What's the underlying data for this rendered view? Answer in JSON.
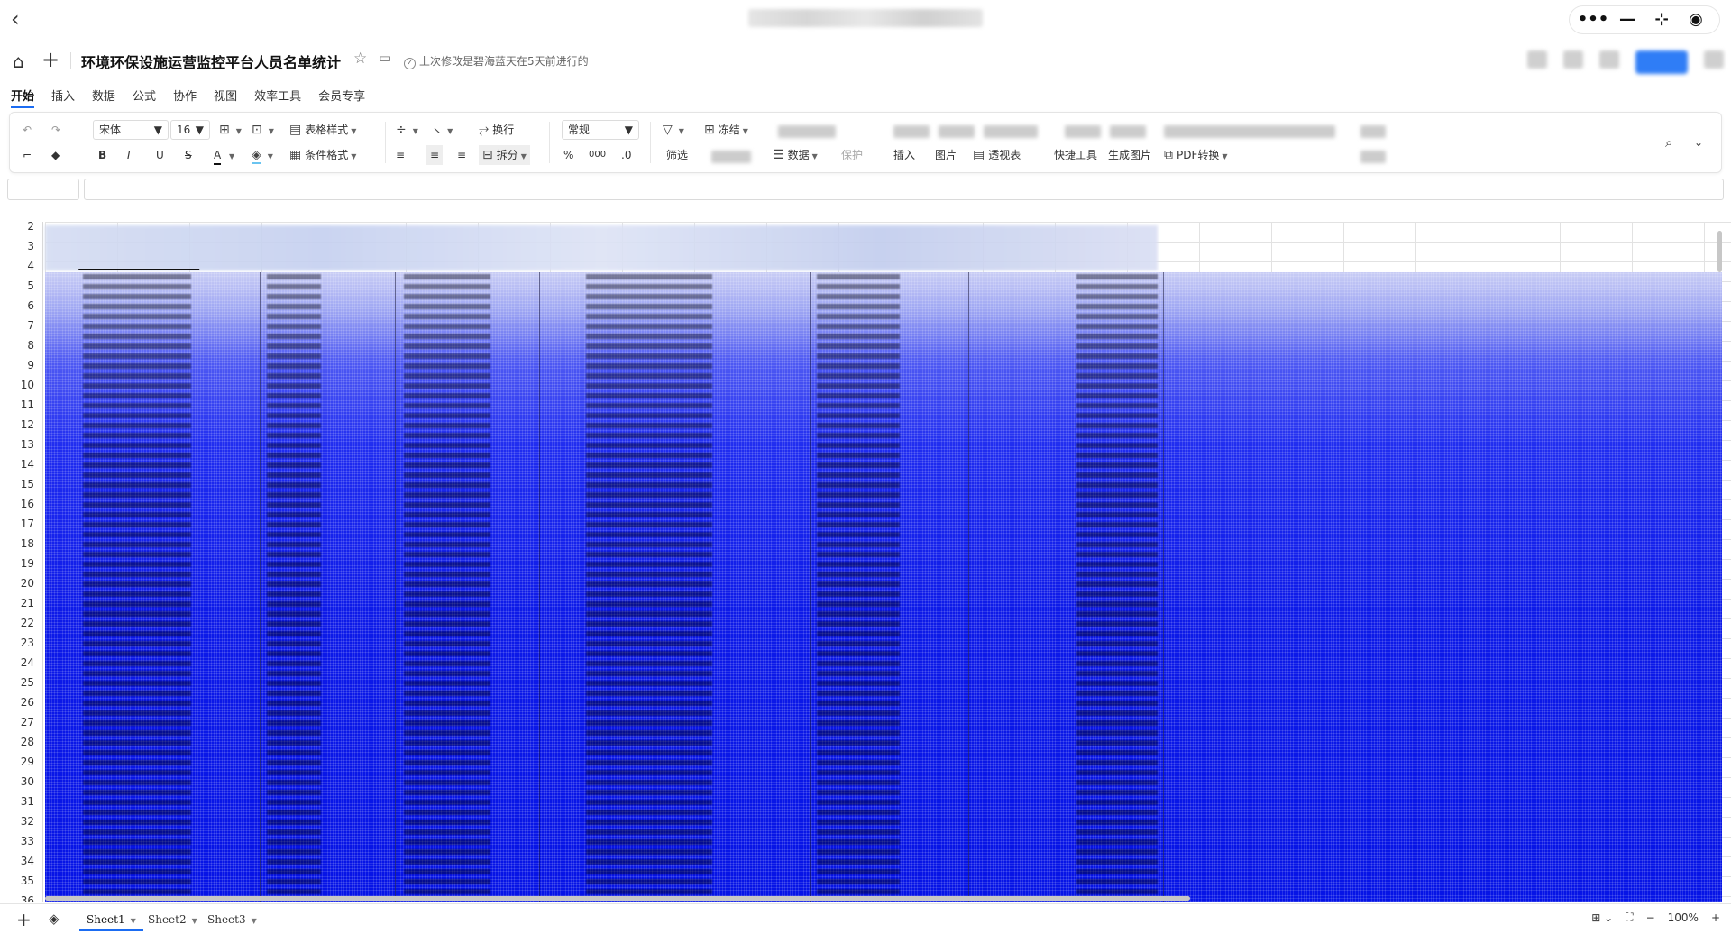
{
  "doc": {
    "title": "环境环保设施运营监控平台人员名单统计",
    "status": "上次修改是碧海蓝天在5天前进行的"
  },
  "menu_tabs": [
    "开始",
    "插入",
    "数据",
    "公式",
    "协作",
    "视图",
    "效率工具",
    "会员专享"
  ],
  "toolbar": {
    "font_name": "宋体",
    "font_size": "16",
    "table_style": "表格样式",
    "cond_format": "条件格式",
    "wrap": "换行",
    "split": "拆分",
    "number_format": "常规",
    "freeze": "冻结",
    "filter": "筛选",
    "data": "数据",
    "protect": "保护",
    "insert": "插入",
    "image": "图片",
    "pivot": "透视表",
    "quick_tools": "快捷工具",
    "gen_image": "生成图片",
    "pdf": "PDF转换",
    "percent": "%",
    "thousands": "000",
    "decimal": ".0",
    "bold": "B",
    "italic": "I",
    "underline": "U",
    "strike": "S",
    "font_color": "A"
  },
  "rows": [
    "2",
    "3",
    "4",
    "5",
    "6",
    "7",
    "8",
    "9",
    "10",
    "11",
    "12",
    "13",
    "14",
    "15",
    "16",
    "17",
    "18",
    "19",
    "20",
    "21",
    "22",
    "23",
    "24",
    "25",
    "26",
    "27",
    "28",
    "29",
    "30",
    "31",
    "32",
    "33",
    "34",
    "35",
    "36"
  ],
  "sheets": [
    "Sheet1",
    "Sheet2",
    "Sheet3"
  ],
  "zoom": "100%",
  "icons": {
    "back": "chevron-left-icon",
    "home": "home-icon",
    "add": "plus-icon",
    "star": "star-icon",
    "folder": "folder-icon",
    "search": "search-icon"
  },
  "colors": {
    "accent": "#1b6cf2",
    "overlay_blue": "#0614e6"
  }
}
